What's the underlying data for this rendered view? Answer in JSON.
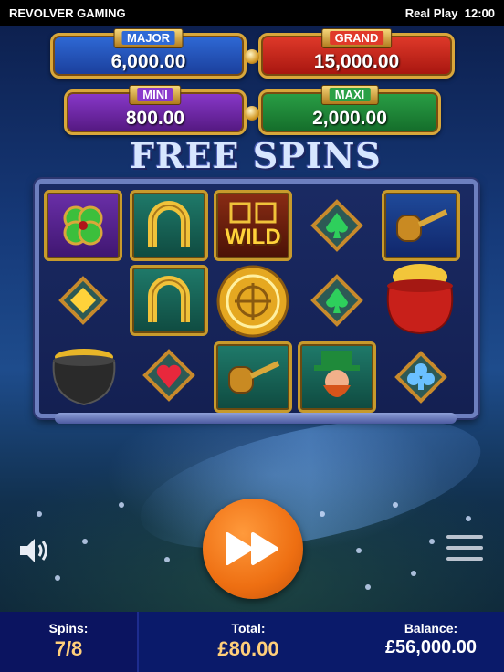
{
  "status_bar": {
    "brand": "REVOLVER GAMING",
    "mode": "Real Play",
    "time": "12:00"
  },
  "jackpots": {
    "major": {
      "label": "MAJOR",
      "value": "6,000.00"
    },
    "grand": {
      "label": "GRAND",
      "value": "15,000.00"
    },
    "mini": {
      "label": "MINI",
      "value": "800.00"
    },
    "maxi": {
      "label": "MAXI",
      "value": "2,000.00"
    }
  },
  "feature_title": "FREE SPINS",
  "reels": {
    "columns": 5,
    "rows": 3,
    "symbols": [
      [
        "clover",
        "gem-gold",
        "black-pot"
      ],
      [
        "horseshoe",
        "horseshoe",
        "heart"
      ],
      [
        "wild",
        "celtic-coin",
        "pipe"
      ],
      [
        "spade",
        "spade",
        "leprechaun"
      ],
      [
        "pipe",
        "pot-of-gold",
        "club"
      ]
    ],
    "wild_label": "WILD"
  },
  "controls": {
    "spin_icon": "fast-forward-icon",
    "sound_icon": "speaker-icon",
    "menu_icon": "hamburger-menu-icon"
  },
  "footer": {
    "spins_label": "Spins:",
    "spins_value": "7/8",
    "total_label": "Total:",
    "total_value": "£80.00",
    "balance_label": "Balance:",
    "balance_value": "£56,000.00"
  },
  "colors": {
    "accent_orange": "#ee6f12",
    "gold": "#d9a73a",
    "footer_bg": "#0a1a6a"
  }
}
